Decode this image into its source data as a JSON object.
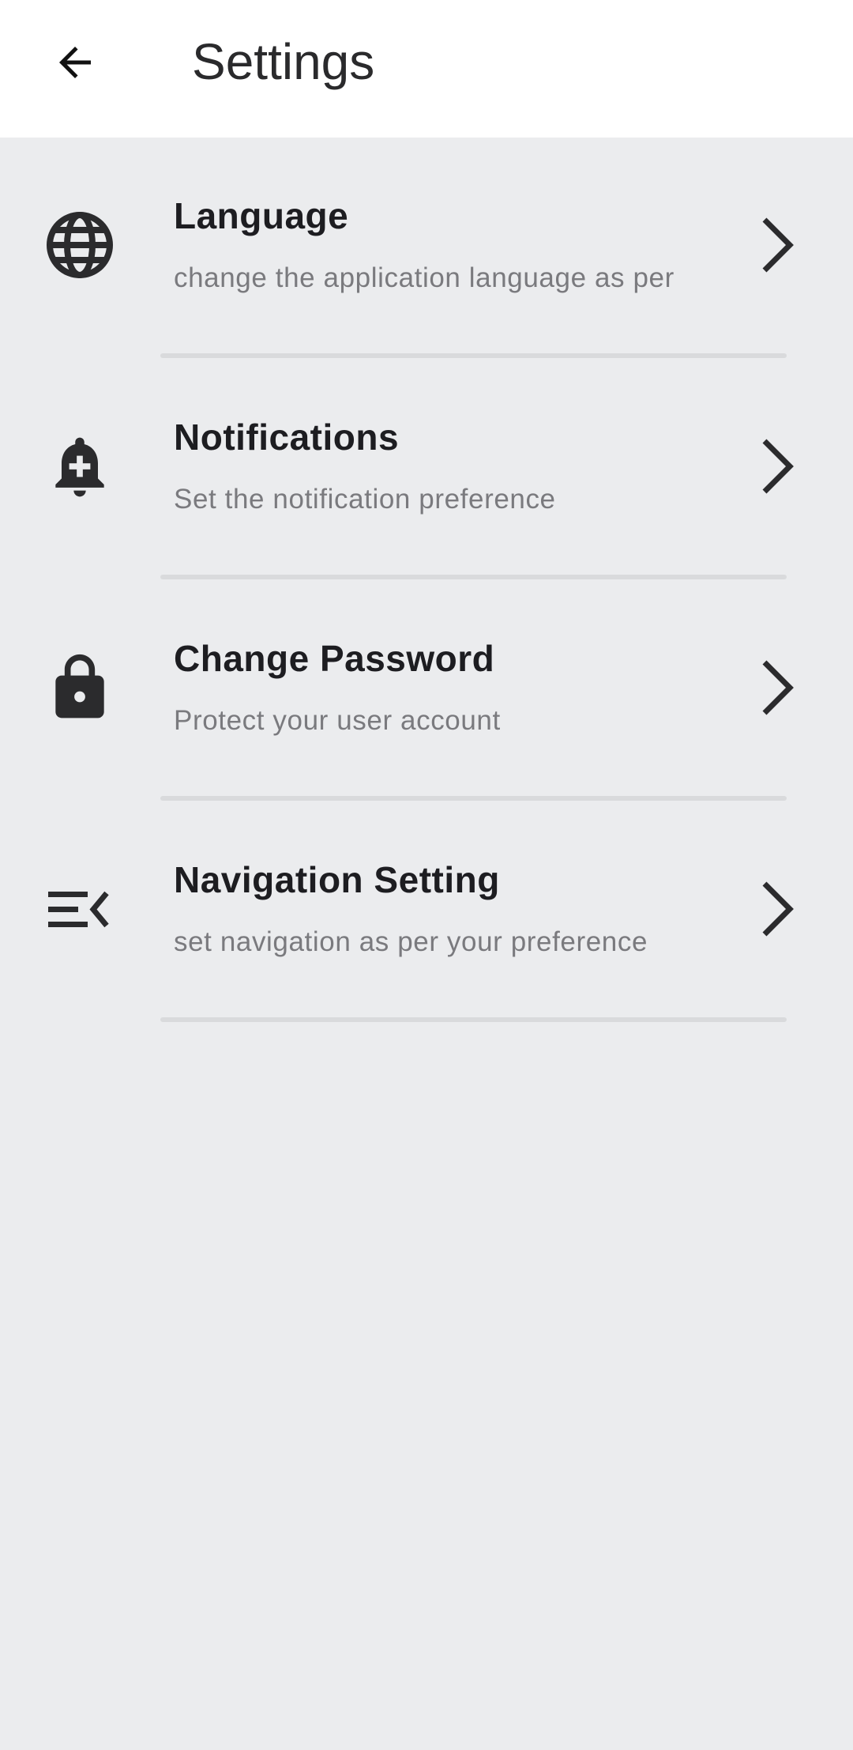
{
  "app_bar": {
    "title": "Settings",
    "back_icon": "arrow-back-icon"
  },
  "colors": {
    "app_bar_background": "#ffffff",
    "page_background": "#ebecee",
    "icon": "#2b2b2d",
    "title_text": "#1d1d21",
    "subtitle_text": "#7a7a7e",
    "divider": "#d9dadc"
  },
  "settings": [
    {
      "title": "Language",
      "subtitle": "change the application language as per",
      "icon": "globe-icon"
    },
    {
      "title": "Notifications",
      "subtitle": "Set the notification preference",
      "icon": "notification-add-icon"
    },
    {
      "title": "Change Password",
      "subtitle": "Protect your user account",
      "icon": "lock-icon"
    },
    {
      "title": "Navigation Setting",
      "subtitle": "set navigation as per your preference",
      "icon": "menu-open-icon"
    }
  ]
}
